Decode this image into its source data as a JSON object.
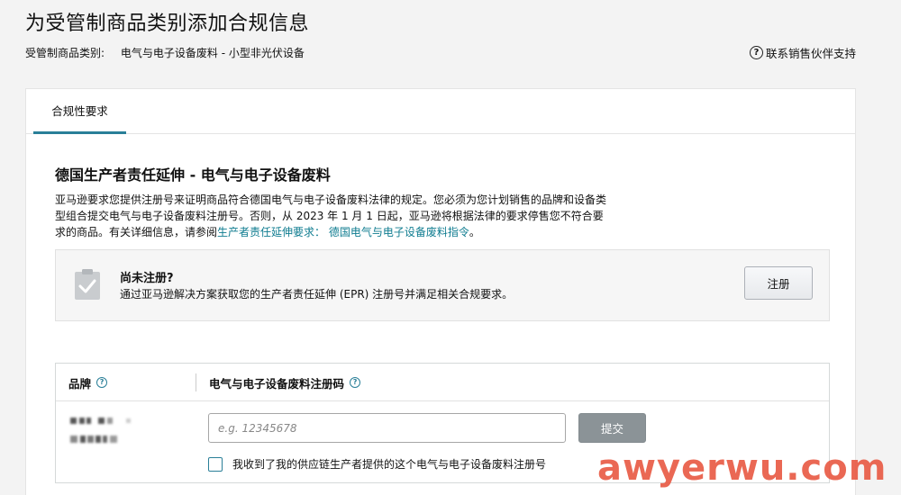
{
  "header": {
    "title": "为受管制商品类别添加合规信息",
    "category_label": "受管制商品类别:",
    "category_value": "电气与电子设备废料 - 小型非光伏设备",
    "help_label": "联系销售伙伴支持",
    "help_icon": "question-circle-icon"
  },
  "tabs": [
    {
      "label": "合规性要求",
      "active": true
    }
  ],
  "section": {
    "title": "德国生产者责任延伸 - 电气与电子设备废料",
    "line1": "亚马逊要求您提供注册号来证明商品符合德国电气与电子设备废料法律的规定。您必须为您计划销售的品牌和设备类",
    "line2": "型组合提交电气与电子设备废料注册号。否则，从 2023 年 1 月 1 日起，亚马逊将根据法律的要求停售您不符合要",
    "line3_prefix": "求的商品。有关详细信息，请参阅",
    "link_text": "生产者责任延伸要求： 德国电气与电子设备废料指令",
    "line3_suffix": "。"
  },
  "notice": {
    "title": "尚未注册?",
    "description": "通过亚马逊解决方案获取您的生产者责任延伸 (EPR) 注册号并满足相关合规要求。",
    "button_label": "注册",
    "icon": "clipboard-check-icon"
  },
  "table": {
    "columns": [
      "品牌",
      "电气与电子设备废料注册码"
    ],
    "rows": [
      {
        "brand": "",
        "input_value": "",
        "input_placeholder": "e.g. 12345678",
        "submit_label": "提交",
        "checkbox_label": "我收到了我的供应链生产者提供的这个电气与电子设备废料注册号",
        "checked": false
      }
    ]
  },
  "watermark": "awyerwu.com",
  "colors": {
    "accent": "#2a7f98",
    "link": "#0f7c90",
    "submit_bg": "#8b9397",
    "watermark": "#e95c46",
    "page_bg": "#f3f3f3"
  }
}
